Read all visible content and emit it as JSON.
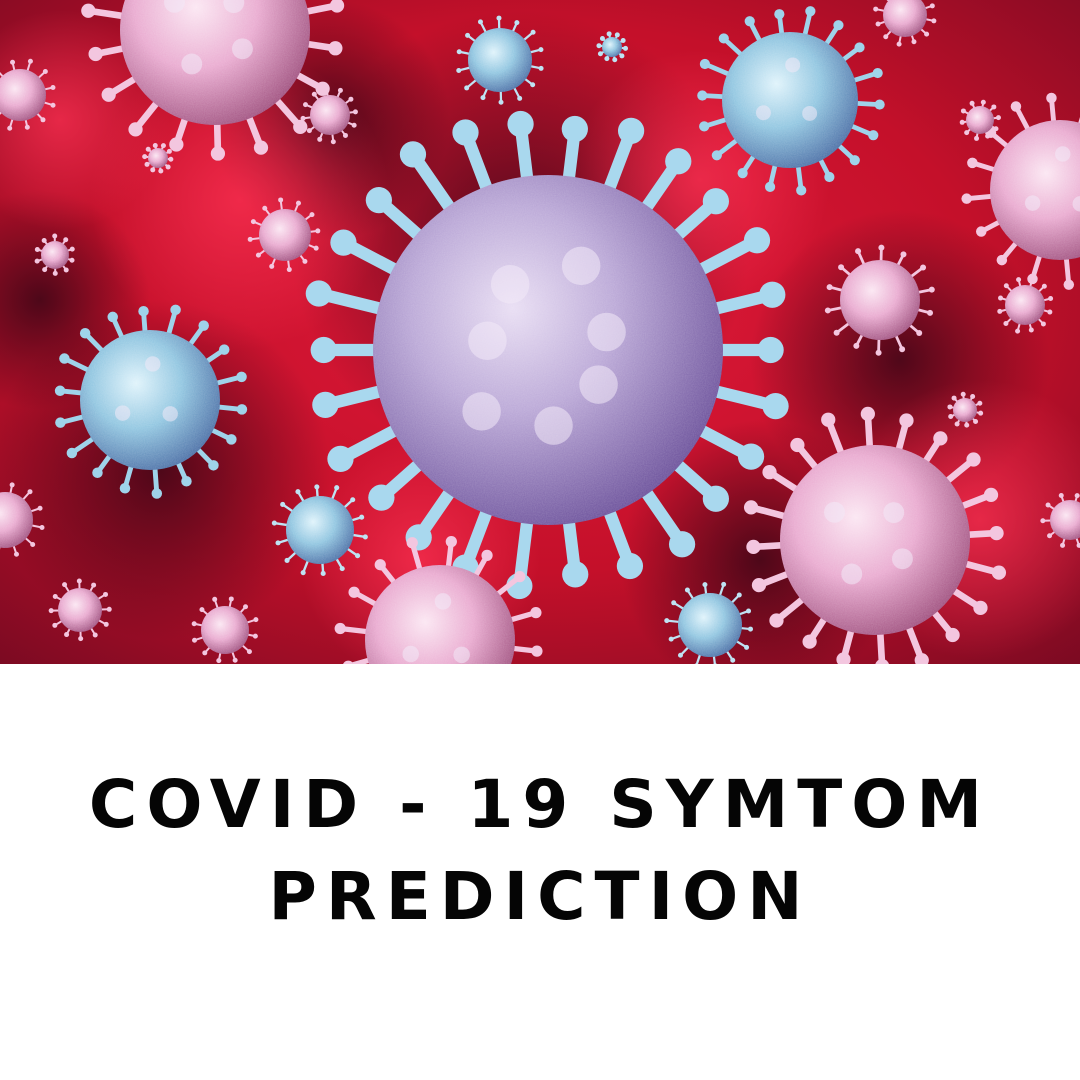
{
  "hero": {
    "subject": "virus-illustration",
    "colors": {
      "background": "#c4102a",
      "background_dark": "#5e0a1e",
      "virus_body": "#b9a6d6",
      "virus_spike": "#9fd3ea",
      "virus_pink": "#e9a9cf"
    }
  },
  "title": {
    "line1": "COVID - 19 SYMTOM",
    "line2": "PREDICTION"
  },
  "colors": {
    "page_background": "#ffffff",
    "title_text": "#050505"
  }
}
